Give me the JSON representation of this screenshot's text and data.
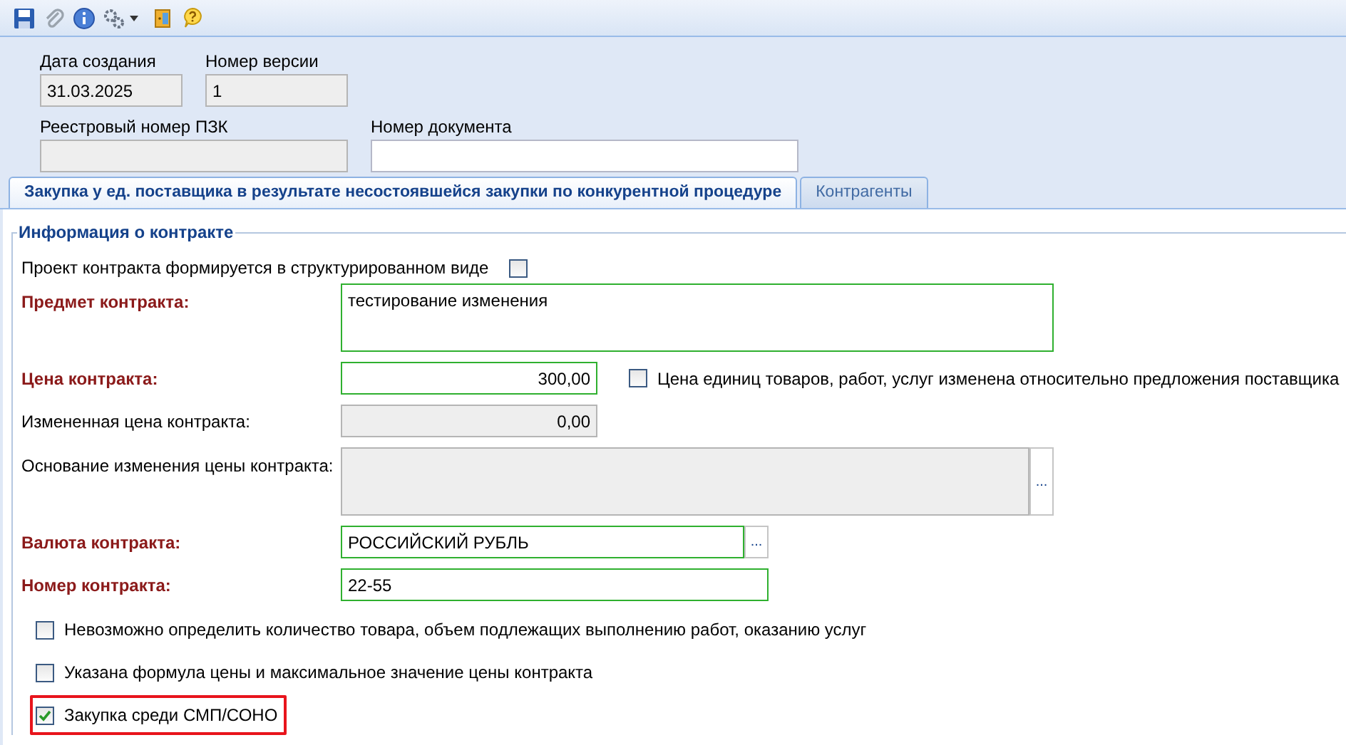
{
  "header_fields": [
    {
      "label": "Дата создания",
      "value": "31.03.2025",
      "disabled": true
    },
    {
      "label": "Номер версии",
      "value": "1",
      "disabled": true
    },
    {
      "label": "Реестровый номер ПЗК",
      "disabled": true
    },
    {
      "label": "Номер документа",
      "disabled": false
    }
  ],
  "tabs": [
    {
      "label": "Закупка у ед. поставщика в результате несостоявшейся закупки по конкурентной процедуре",
      "selected": true
    },
    {
      "label": "Контрагенты",
      "selected": false
    }
  ],
  "section": {
    "title": "Информация о контракте",
    "rows": [
      {
        "kind": "check-after",
        "label": "Проект контракта формируется в структурированном виде",
        "checked": false
      },
      {
        "kind": "textarea",
        "label": "Предмет контракта:",
        "required": true,
        "disabled": false,
        "value": "тестирование изменения"
      },
      {
        "kind": "number",
        "label": "Цена контракта:",
        "required": true,
        "disabled": false,
        "value": "300,00",
        "side_check": {
          "label": "Цена единиц товаров, работ, услуг изменена относительно предложения поставщика",
          "checked": false
        }
      },
      {
        "kind": "number",
        "label": "Измененная цена контракта:",
        "required": false,
        "disabled": true,
        "value": "0,00"
      },
      {
        "kind": "textarea-picker",
        "label": "Основание изменения цены контракта:",
        "required": false,
        "disabled": true,
        "button_label": "..."
      },
      {
        "kind": "picker",
        "label": "Валюта контракта:",
        "required": true,
        "disabled": false,
        "value": "РОССИЙСКИЙ РУБЛЬ",
        "button_label": "..."
      },
      {
        "kind": "text",
        "label": "Номер контракта:",
        "required": true,
        "disabled": false,
        "value": "22-55"
      },
      {
        "kind": "check",
        "label": "Невозможно определить количество товара, объем подлежащих выполнению работ, оказанию услуг",
        "checked": false,
        "highlighted": false
      },
      {
        "kind": "check",
        "label": "Указана формула цены и максимальное значение цены контракта",
        "checked": false,
        "highlighted": false
      },
      {
        "kind": "check",
        "label": "Закупка среди СМП/СОНО",
        "checked": true,
        "highlighted": true
      }
    ]
  }
}
